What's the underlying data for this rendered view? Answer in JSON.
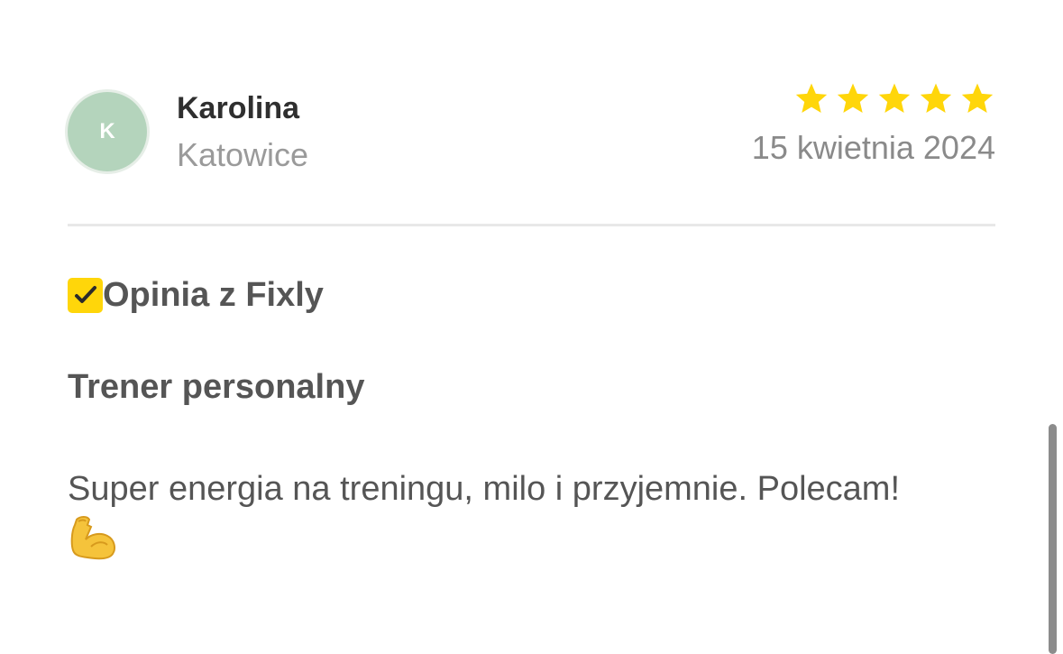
{
  "review": {
    "author": {
      "initial": "K",
      "name": "Karolina",
      "city": "Katowice"
    },
    "rating": 5,
    "date": "15 kwietnia 2024",
    "badge": {
      "label": "Opinia z Fixly",
      "icon": "check-icon"
    },
    "category": "Trener personalny",
    "text": "Super energia na treningu, milo i przyjemnie. Polecam!",
    "emoji": "flexed-biceps-icon"
  },
  "colors": {
    "star": "#ffd60a",
    "badge": "#ffd60a",
    "avatar": "#b4d4bc"
  }
}
